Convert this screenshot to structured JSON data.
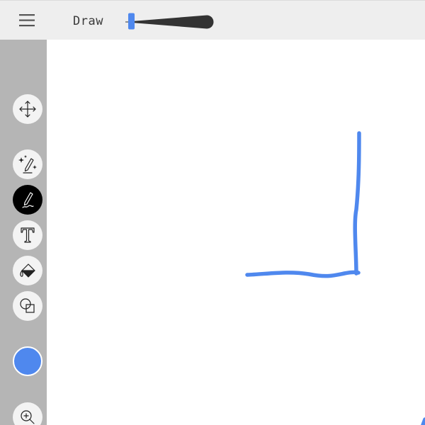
{
  "toolbar": {
    "mode_label": "Draw",
    "brush_size_icon": "brush-size-slider",
    "slider_color": "#4f88ee",
    "brush_color": "#333333"
  },
  "sidebar": {
    "tools": [
      {
        "id": "move",
        "icon": "move-icon",
        "active": false
      },
      {
        "id": "magic-pen",
        "icon": "magic-pen-icon",
        "active": false
      },
      {
        "id": "pen",
        "icon": "pen-icon",
        "active": true
      },
      {
        "id": "text",
        "icon": "text-icon",
        "active": false
      },
      {
        "id": "fill",
        "icon": "paint-bucket-icon",
        "active": false
      },
      {
        "id": "shapes",
        "icon": "shapes-icon",
        "active": false
      },
      {
        "id": "zoom",
        "icon": "zoom-in-icon",
        "active": false
      }
    ],
    "current_color": "#4f88ee"
  },
  "canvas": {
    "stroke_color": "#4f88ee"
  }
}
